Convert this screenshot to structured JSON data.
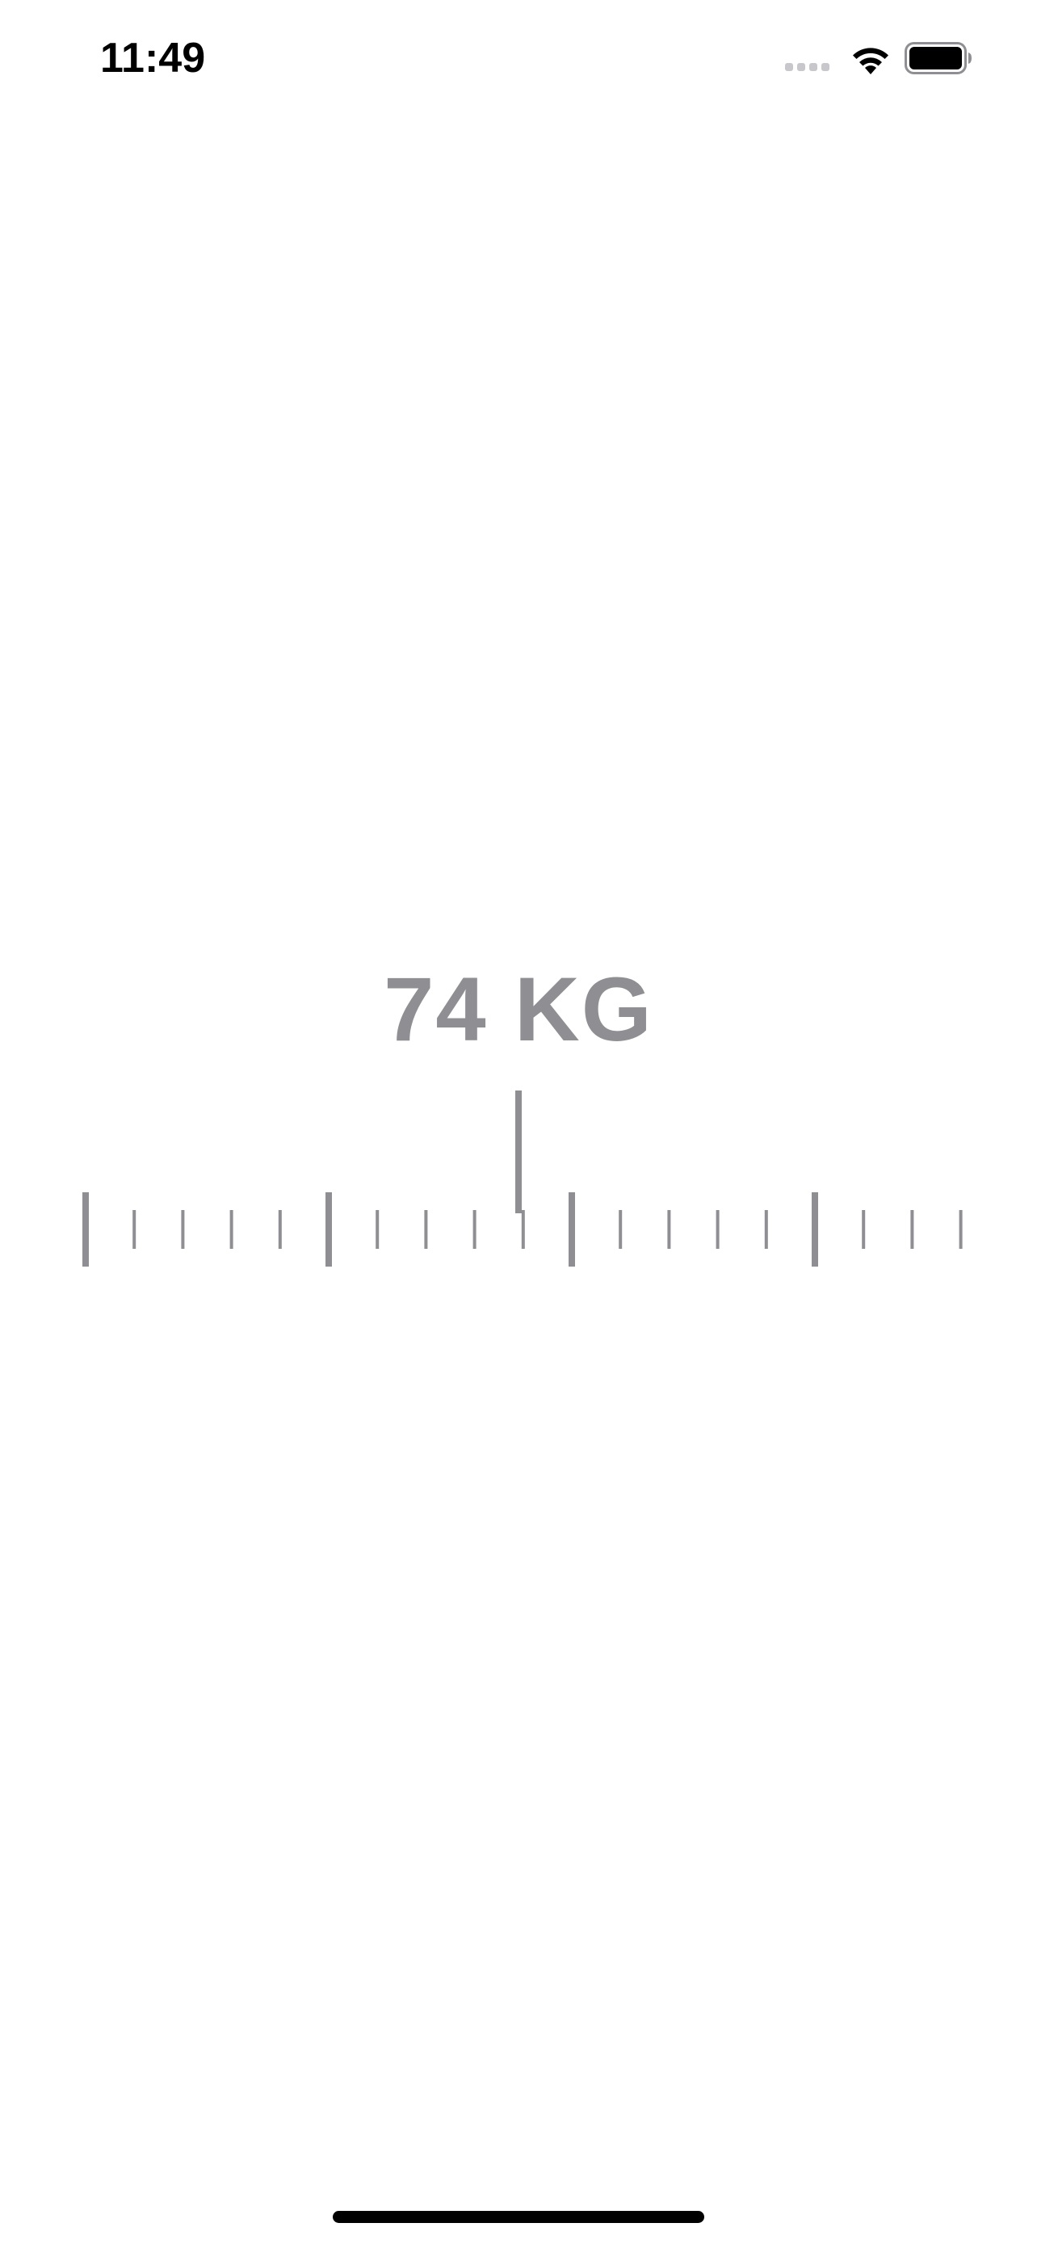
{
  "status_bar": {
    "time": "11:49",
    "icons": [
      "cellular-signal-icon",
      "wifi-icon",
      "battery-icon"
    ]
  },
  "weight_picker": {
    "value": 74,
    "unit": "KG",
    "display": "74 KG",
    "accent_color": "#8e8e93"
  }
}
